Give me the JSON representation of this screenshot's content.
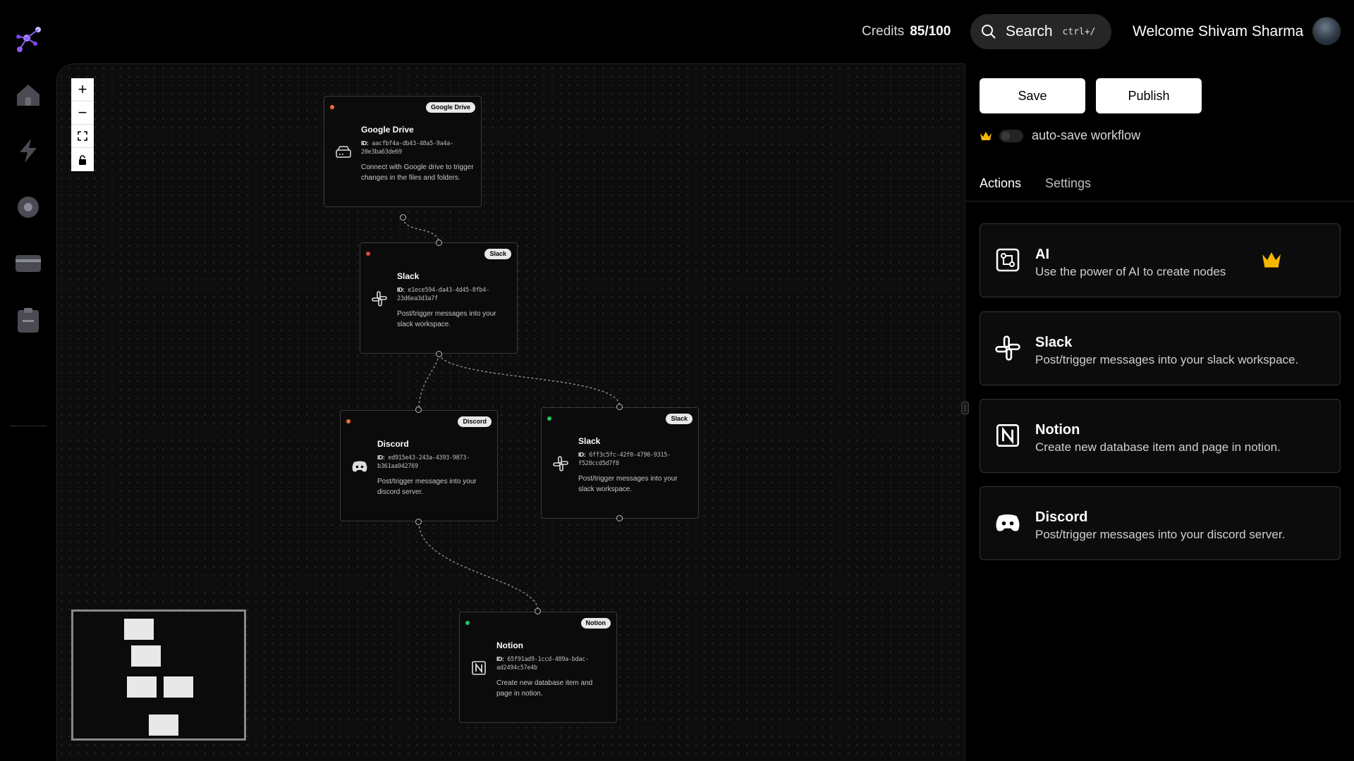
{
  "header": {
    "credits_label": "Credits",
    "credits_value": "85/100",
    "search_label": "Search",
    "search_shortcut": "ctrl+/",
    "welcome": "Welcome Shivam Sharma"
  },
  "sidebar": {
    "items": [
      {
        "icon": "home-icon"
      },
      {
        "icon": "lightning-icon"
      },
      {
        "icon": "settings-icon"
      },
      {
        "icon": "billing-card-icon"
      },
      {
        "icon": "clipboard-icon"
      }
    ]
  },
  "canvas": {
    "zoom_controls": [
      "+",
      "−"
    ],
    "nodes": [
      {
        "title": "Google Drive",
        "badge": "Google Drive",
        "id_label": "ID:",
        "id": "aacfbf4a-db43-48a5-9a4a-20e3ba63de69",
        "description": "Connect with Google drive to trigger changes in the files and folders.",
        "status_color": "#f26b3a",
        "icon": "hard-drive-icon"
      },
      {
        "title": "Slack",
        "badge": "Slack",
        "id_label": "ID:",
        "id": "e1ece594-da43-4d45-8fb4-23d6ea3d3a7f",
        "description": "Post/trigger messages into your slack workspace.",
        "status_color": "#e2473a",
        "icon": "slack-icon"
      },
      {
        "title": "Discord",
        "badge": "Discord",
        "id_label": "ID:",
        "id": "ed915e43-243a-4393-9873-b361aa942769",
        "description": "Post/trigger messages into your discord server.",
        "status_color": "#f26b3a",
        "icon": "discord-icon"
      },
      {
        "title": "Slack",
        "badge": "Slack",
        "id_label": "ID:",
        "id": "6ff3c5fc-42f0-4790-9315-f528ccd5d7f8",
        "description": "Post/trigger messages into your slack workspace.",
        "status_color": "#22c55e",
        "icon": "slack-icon"
      },
      {
        "title": "Notion",
        "badge": "Notion",
        "id_label": "ID:",
        "id": "65f91ad9-1ccd-489a-bdac-ad2494c57e4b",
        "description": "Create new database item and page in notion.",
        "status_color": "#22c55e",
        "icon": "notion-icon"
      }
    ]
  },
  "panel": {
    "save_label": "Save",
    "publish_label": "Publish",
    "autosave_label": "auto-save workflow",
    "tabs": [
      "Actions",
      "Settings"
    ],
    "actions": [
      {
        "title": "AI",
        "description": "Use the power of AI to create nodes",
        "icon": "ai-circuit-icon",
        "premium": true
      },
      {
        "title": "Slack",
        "description": "Post/trigger messages into your slack workspace.",
        "icon": "slack-icon"
      },
      {
        "title": "Notion",
        "description": "Create new database item and page in notion.",
        "icon": "notion-icon"
      },
      {
        "title": "Discord",
        "description": "Post/trigger messages into your discord server.",
        "icon": "discord-icon"
      }
    ],
    "crown_color": "#f5b800"
  }
}
